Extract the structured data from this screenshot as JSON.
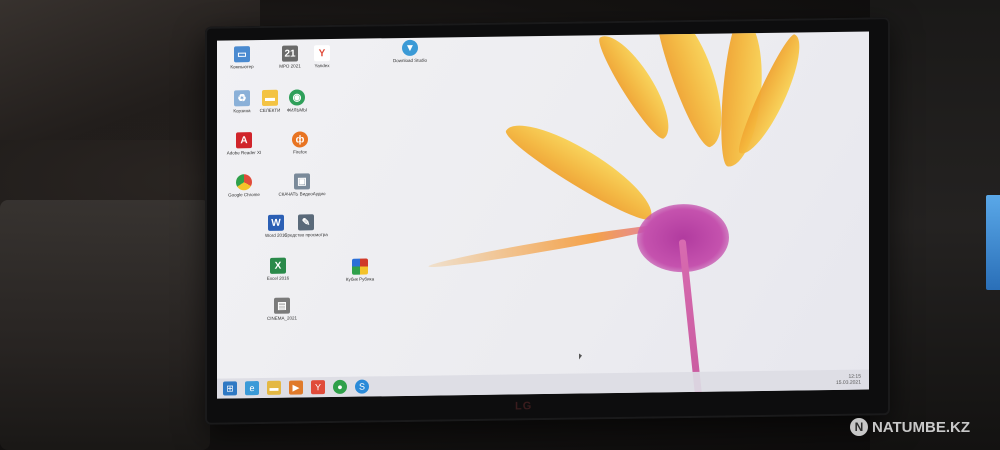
{
  "monitor": {
    "brand": "LG"
  },
  "desktop": {
    "icons": [
      {
        "label": "Компьютер",
        "icon": "computer-icon",
        "color": "#4a8ad0"
      },
      {
        "label": "МРО 2021",
        "icon": "app-icon",
        "color": "#6a6a6a"
      },
      {
        "label": "Yandex",
        "icon": "yandex-icon",
        "color": "#e04b3a"
      },
      {
        "label": "Download Studio",
        "icon": "download-studio-icon",
        "color": "#3b9ad6"
      },
      {
        "label": "Корзина",
        "icon": "recycle-bin-icon",
        "color": "#8ab0d8"
      },
      {
        "label": "СЕЛЕКТИ",
        "icon": "folder-icon",
        "color": "#f3c343"
      },
      {
        "label": "ФИЛЬМЫ",
        "icon": "media-icon",
        "color": "#2fa05a"
      },
      {
        "label": "Adobe Reader XI",
        "icon": "pdf-icon",
        "color": "#d0242a"
      },
      {
        "label": "Firefox",
        "icon": "firefox-icon",
        "color": "#e87422"
      },
      {
        "label": "Google Chrome",
        "icon": "chrome-icon",
        "color": "#2fa04a"
      },
      {
        "label": "СКАЧАТЬ ВидеоАудио",
        "icon": "downloader-icon",
        "color": "#7a8a9a"
      },
      {
        "label": "Word 2016",
        "icon": "word-icon",
        "color": "#2b5fb4"
      },
      {
        "label": "Средство просмотра",
        "icon": "viewer-icon",
        "color": "#5a6a7a"
      },
      {
        "label": "Excel 2016",
        "icon": "excel-icon",
        "color": "#2a8a4a"
      },
      {
        "label": "Кубик Рубика",
        "icon": "rubik-icon",
        "color": "#d03a2a"
      },
      {
        "label": "CINEMA_2021",
        "icon": "document-icon",
        "color": "#7a7a7a"
      }
    ]
  },
  "taskbar": {
    "items": [
      {
        "icon": "start-icon",
        "color": "#2f79c4"
      },
      {
        "icon": "explorer-icon",
        "color": "#3a9ad8"
      },
      {
        "icon": "folder-icon",
        "color": "#e4b843"
      },
      {
        "icon": "media-player-icon",
        "color": "#e07a2a"
      },
      {
        "icon": "yandex-icon",
        "color": "#e04b3a"
      },
      {
        "icon": "chrome-icon",
        "color": "#2fa04a"
      },
      {
        "icon": "skype-icon",
        "color": "#2a8ad8"
      }
    ],
    "tray_time": "12:15",
    "tray_date": "15.03.2021"
  },
  "watermark": {
    "text": "NATUMBE.KZ"
  }
}
